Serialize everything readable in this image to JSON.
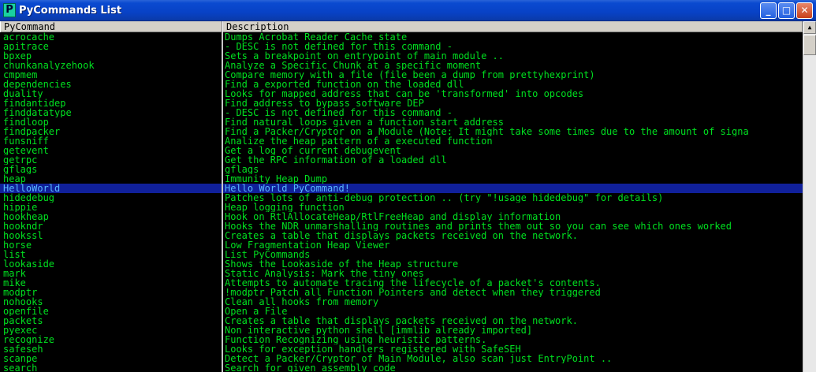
{
  "window": {
    "title": "PyCommands List",
    "app_icon_letter": "P",
    "minimize_glyph": "_",
    "maximize_glyph": "□",
    "close_glyph": "✕"
  },
  "columns": {
    "command": "PyCommand",
    "description": "Description"
  },
  "selected_index": 17,
  "rows": [
    {
      "cmd": "acrocache",
      "desc": "Dumps Acrobat Reader Cache state"
    },
    {
      "cmd": "apitrace",
      "desc": "- DESC is not defined for this command -"
    },
    {
      "cmd": "bpxep",
      "desc": "Sets a breakpoint on entrypoint of main module .."
    },
    {
      "cmd": "chunkanalyzehook",
      "desc": "Analyze a Specific Chunk at a specific moment"
    },
    {
      "cmd": "cmpmem",
      "desc": "Compare memory with a file (file been a dump from prettyhexprint)"
    },
    {
      "cmd": "dependencies",
      "desc": "Find a exported function on the loaded dll"
    },
    {
      "cmd": "duality",
      "desc": "Looks for mapped address that can be 'transformed' into opcodes"
    },
    {
      "cmd": "findantidep",
      "desc": "Find address to bypass software DEP"
    },
    {
      "cmd": "finddatatype",
      "desc": "- DESC is not defined for this command -"
    },
    {
      "cmd": "findloop",
      "desc": " Find natural loops given a function start address"
    },
    {
      "cmd": "findpacker",
      "desc": "Find a Packer/Cryptor on a Module (Note: It might take some times due to the amount of signa"
    },
    {
      "cmd": "funsniff",
      "desc": "Analize the heap pattern of a executed function"
    },
    {
      "cmd": "getevent",
      "desc": "Get a log of current debugevent"
    },
    {
      "cmd": "getrpc",
      "desc": "Get the RPC information of a loaded dll"
    },
    {
      "cmd": "gflags",
      "desc": "gflags"
    },
    {
      "cmd": "heap",
      "desc": "Immunity Heap Dump"
    },
    {
      "cmd": "HelloWorld",
      "desc": "Hello World PyCommand!"
    },
    {
      "cmd": "hidedebug",
      "desc": "Patches lots of anti-debug protection ..  (try \"!usage hidedebug\" for details)"
    },
    {
      "cmd": "hippie",
      "desc": "Heap logging function"
    },
    {
      "cmd": "hookheap",
      "desc": "Hook on RtlAllocateHeap/RtlFreeHeap and display information"
    },
    {
      "cmd": "hookndr",
      "desc": "Hooks the NDR unmarshalling routines and prints them out so you can see which ones worked"
    },
    {
      "cmd": "hookssl",
      "desc": "Creates a table that displays packets received on the network."
    },
    {
      "cmd": "horse",
      "desc": "Low Fragmentation Heap Viewer"
    },
    {
      "cmd": "list",
      "desc": "List PyCommands"
    },
    {
      "cmd": "lookaside",
      "desc": "Shows the Lookaside of the Heap structure"
    },
    {
      "cmd": "mark",
      "desc": "Static Analysis: Mark the tiny ones"
    },
    {
      "cmd": "mike",
      "desc": "Attempts to automate tracing the lifecycle of a packet's contents."
    },
    {
      "cmd": "modptr",
      "desc": "!modptr Patch all Function Pointers and detect when they triggered"
    },
    {
      "cmd": "nohooks",
      "desc": "Clean all hooks from memory"
    },
    {
      "cmd": "openfile",
      "desc": "Open a File"
    },
    {
      "cmd": "packets",
      "desc": "Creates a table that displays packets received on the network."
    },
    {
      "cmd": "pyexec",
      "desc": "Non interactive python shell [immlib already imported]"
    },
    {
      "cmd": "recognize",
      "desc": "Function Recognizing using heuristic patterns."
    },
    {
      "cmd": "safeseh",
      "desc": "Looks for exception handlers registered with SafeSEH"
    },
    {
      "cmd": "scanpe",
      "desc": "Detect a Packer/Cryptor of Main Module, also scan just EntryPoint .."
    },
    {
      "cmd": "search",
      "desc": "Search for given assembly code"
    }
  ],
  "colors": {
    "text": "#00e020",
    "background": "#000000",
    "selection_bg": "#10209a",
    "selection_text": "#58b8ff"
  },
  "scrollbar": {
    "up_glyph": "▲"
  }
}
